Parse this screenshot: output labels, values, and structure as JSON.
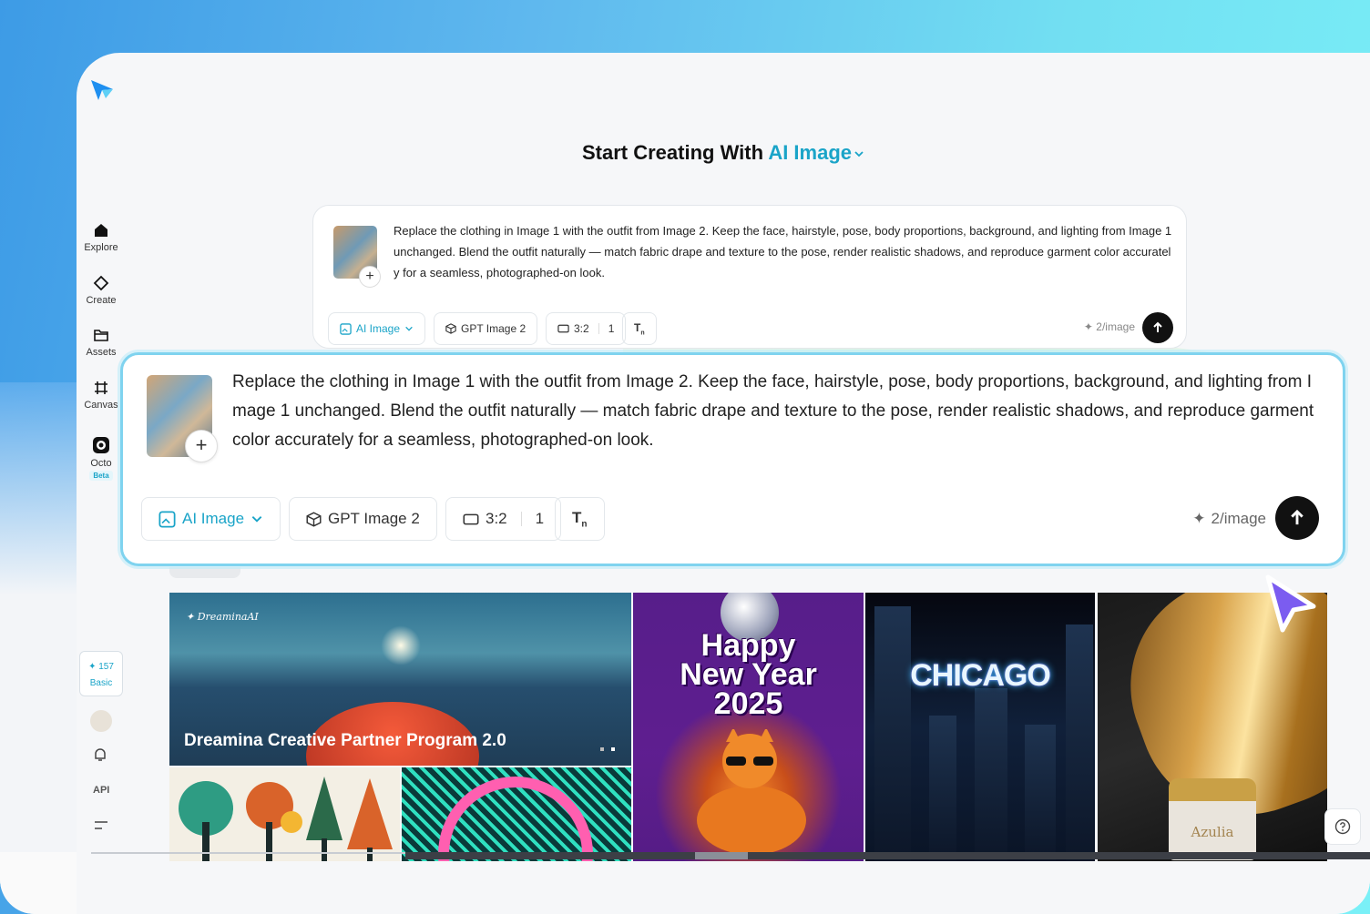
{
  "sidebar": {
    "items": [
      {
        "label": "Explore",
        "icon": "home-icon"
      },
      {
        "label": "Create",
        "icon": "diamond-icon"
      },
      {
        "label": "Assets",
        "icon": "folder-icon"
      },
      {
        "label": "Canvas",
        "icon": "frame-icon"
      },
      {
        "label": "Octo",
        "icon": "octo-icon",
        "badge": "Beta"
      }
    ],
    "credits": {
      "count": "157",
      "plan": "Basic"
    },
    "api_label": "API"
  },
  "headline": {
    "prefix": "Start Creating With",
    "mode": "AI Image"
  },
  "prompt": {
    "text": "Replace the clothing in Image 1 with the outfit from Image 2. Keep the face, hairstyle, pose, body proportions, background, and lighting from Image 1 unchanged. Blend the outfit naturally — match fabric drape and texture to the pose, render realistic shadows, and reproduce garment color accurately for a seamless, photographed-on look.",
    "mode_label": "AI Image",
    "model_label": "GPT Image 2",
    "ratio_label": "3:2",
    "count_label": "1",
    "cost_label": "2/image"
  },
  "gallery": {
    "banner_brand": "DreaminaAI",
    "banner_caption": "Dreamina Creative Partner Program 2.0",
    "party_title": "Happy New Year 2025",
    "party_lines": [
      "Happy",
      "New Year",
      "2025"
    ],
    "chicago_title": "CHICAGO",
    "product_label": "Azulia"
  },
  "colors": {
    "accent": "#1aa4c8",
    "focus_border": "#7fd3ef",
    "cursor": "#7b5cf0"
  }
}
